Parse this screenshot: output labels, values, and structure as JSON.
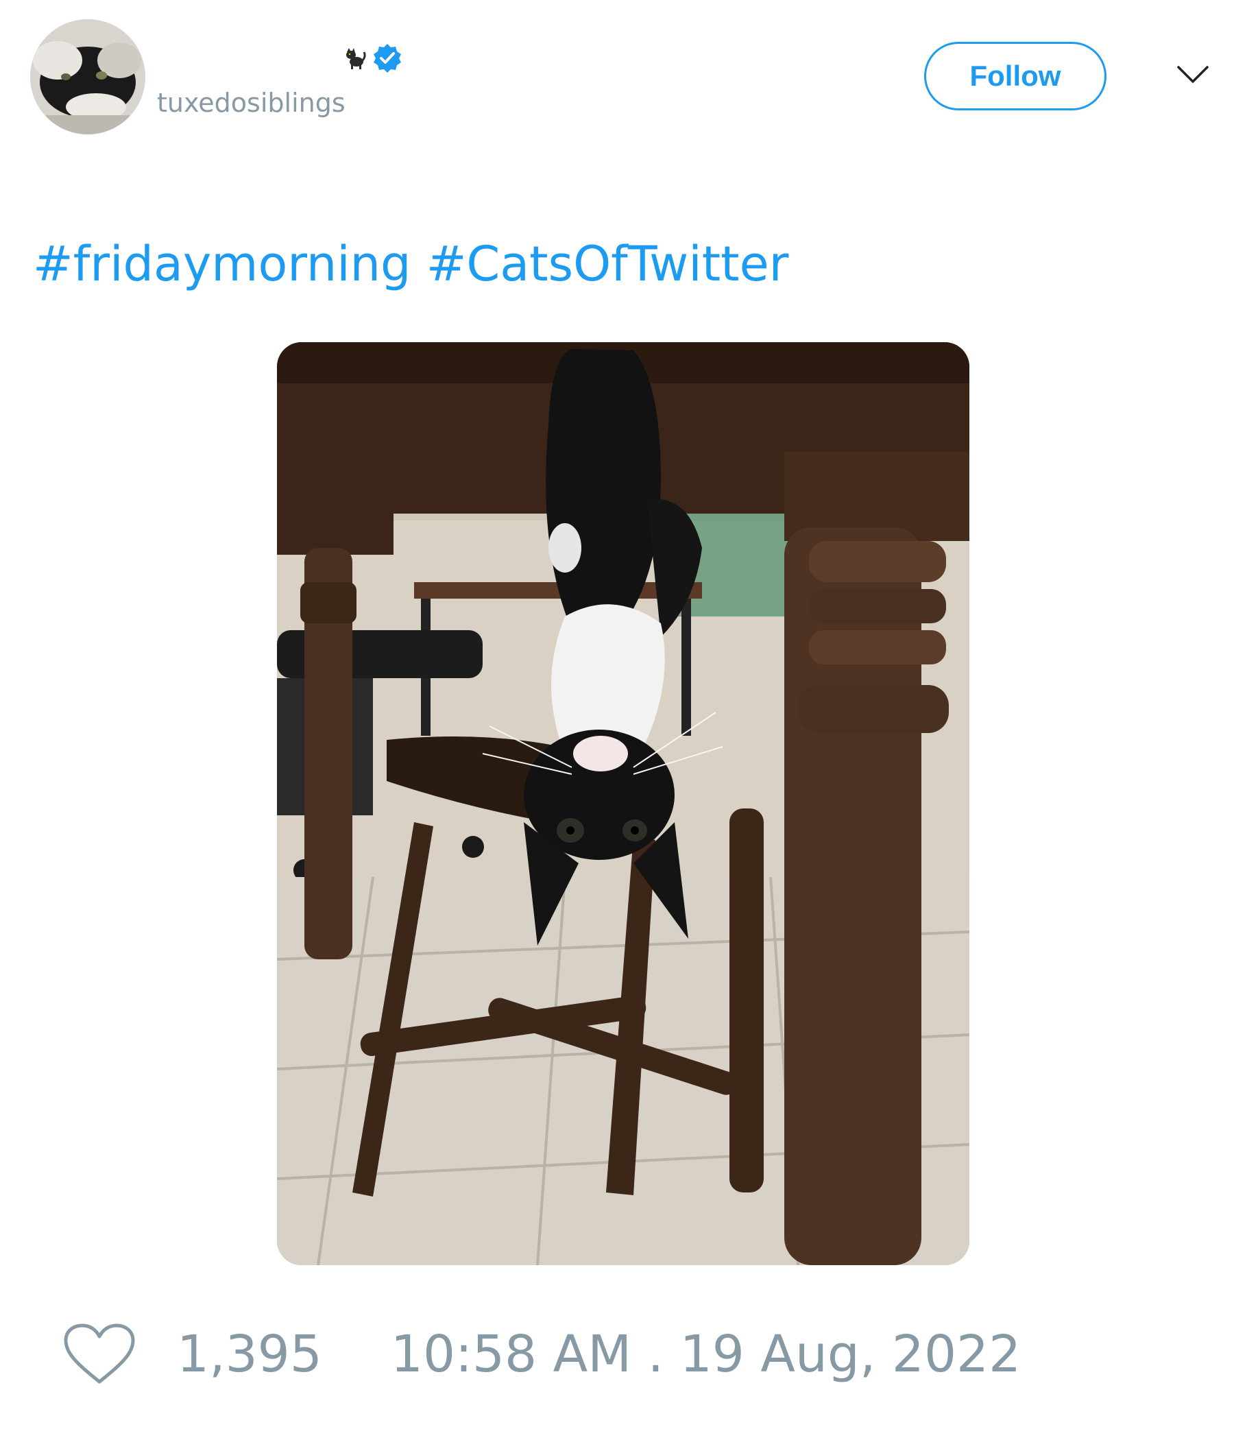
{
  "author": {
    "display_name_emoji": "🐈‍⬛",
    "handle": "tuxedosiblings",
    "verified": true,
    "avatar_icon": "tuxedo-cat-avatar"
  },
  "header": {
    "follow_label": "Follow",
    "menu_icon": "chevron-down-icon"
  },
  "tweet": {
    "hashtags": [
      "#fridaymorning",
      "#CatsOfTwitter"
    ],
    "media_icon": "photo-cat-hanging-under-table"
  },
  "footer": {
    "like_icon": "heart-icon",
    "like_count": "1,395",
    "timestamp": "10:58 AM . 19 Aug, 2022"
  },
  "colors": {
    "accent": "#1d9bf0",
    "muted_text": "#8899a6",
    "background": "#ffffff"
  }
}
